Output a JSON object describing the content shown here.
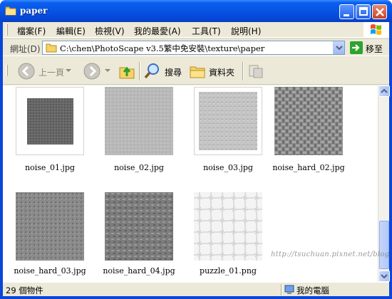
{
  "window": {
    "title": "paper",
    "folder_icon": "folder-icon",
    "controls": [
      "minimize-icon",
      "maximize-icon",
      "close-icon"
    ],
    "title_color": "#0754e3"
  },
  "menu": {
    "items": [
      "檔案(F)",
      "編輯(E)",
      "檢視(V)",
      "我的最愛(A)",
      "工具(T)",
      "說明(H)"
    ]
  },
  "address": {
    "label": "網址(D)",
    "path": "C:\\chen\\PhotoScape v3.5繁中免安裝\\texture\\paper",
    "go_label": "移至"
  },
  "toolbar": {
    "back_label": "上一頁",
    "search_label": "搜尋",
    "folders_label": "資料夾"
  },
  "files": [
    {
      "name": "noise_01.jpg"
    },
    {
      "name": "noise_02.jpg"
    },
    {
      "name": "noise_03.jpg"
    },
    {
      "name": "noise_hard_02.jpg"
    },
    {
      "name": "noise_hard_03.jpg"
    },
    {
      "name": "noise_hard_04.jpg"
    },
    {
      "name": "puzzle_01.png"
    }
  ],
  "status": {
    "count_text": "29 個物件",
    "location_text": "我的電腦"
  },
  "watermark": "http://tsuchuan.pixnet.net/blog"
}
